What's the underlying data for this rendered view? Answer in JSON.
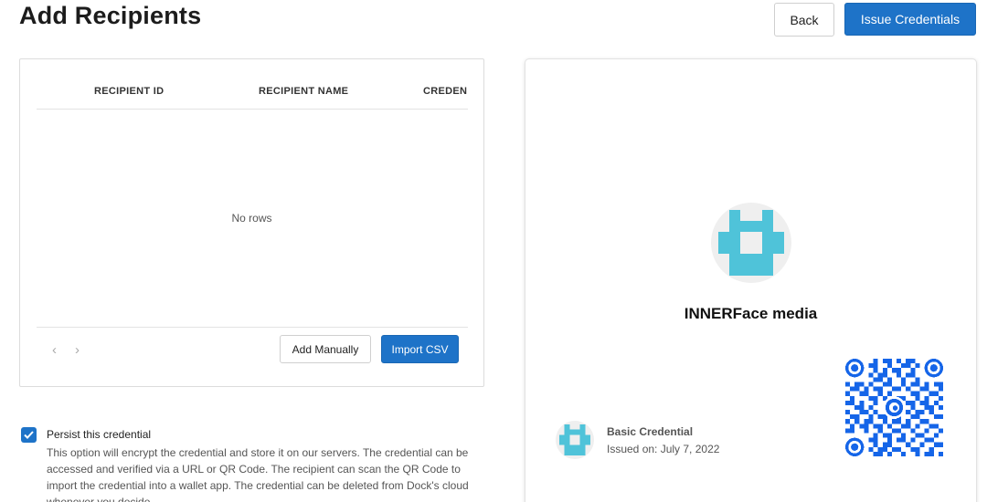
{
  "header": {
    "title": "Add Recipients",
    "back_label": "Back",
    "issue_label": "Issue Credentials"
  },
  "table": {
    "columns": [
      "RECIPIENT ID",
      "RECIPIENT NAME",
      "CREDEN"
    ],
    "empty_text": "No rows",
    "pager_prev": "‹",
    "pager_next": "›",
    "add_manually_label": "Add Manually",
    "import_csv_label": "Import CSV"
  },
  "persist": {
    "checked": true,
    "label": "Persist this credential",
    "description": "This option will encrypt the credential and store it on our servers. The credential can be accessed and verified via a URL or QR Code. The recipient can scan the QR Code to import the credential into a wallet app. The credential can be deleted from Dock's cloud whenever you decide."
  },
  "preview": {
    "org_name": "INNERFace media",
    "credential_title": "Basic Credential",
    "issued_on": "Issued on: July 7, 2022"
  },
  "colors": {
    "accent": "#1e73c8",
    "logo": "#4fc3d9",
    "qr": "#1565e8"
  }
}
